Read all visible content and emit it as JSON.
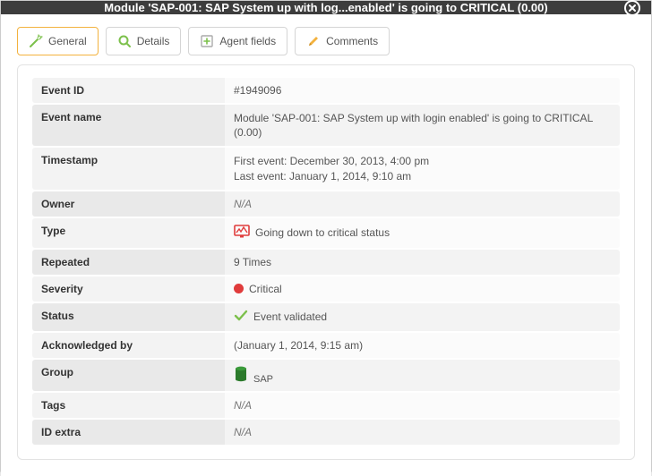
{
  "modal": {
    "title": "Module 'SAP-001: SAP System up with log...enabled' is going to CRITICAL (0.00)"
  },
  "tabs": {
    "general": "General",
    "details": "Details",
    "agent_fields": "Agent fields",
    "comments": "Comments"
  },
  "fields": {
    "event_id": {
      "label": "Event ID",
      "value": "#1949096"
    },
    "event_name": {
      "label": "Event name",
      "value": "Module 'SAP-001: SAP System up with login enabled' is going to CRITICAL (0.00)"
    },
    "timestamp": {
      "label": "Timestamp",
      "line1": "First event: December 30, 2013, 4:00 pm",
      "line2": "Last event: January 1, 2014, 9:10 am"
    },
    "owner": {
      "label": "Owner",
      "value": "N/A"
    },
    "type": {
      "label": "Type",
      "value": "Going down to critical status"
    },
    "repeated": {
      "label": "Repeated",
      "value": "9 Times"
    },
    "severity": {
      "label": "Severity",
      "value": "Critical"
    },
    "status": {
      "label": "Status",
      "value": "Event validated"
    },
    "ack_by": {
      "label": "Acknowledged by",
      "value": "(January 1, 2014, 9:15 am)"
    },
    "group": {
      "label": "Group",
      "value": "SAP"
    },
    "tags": {
      "label": "Tags",
      "value": "N/A"
    },
    "id_extra": {
      "label": "ID extra",
      "value": "N/A"
    }
  },
  "icons": {
    "critical_color": "#e03c3c",
    "check_color": "#7cc04b",
    "group_color": "#2b7a2b"
  }
}
